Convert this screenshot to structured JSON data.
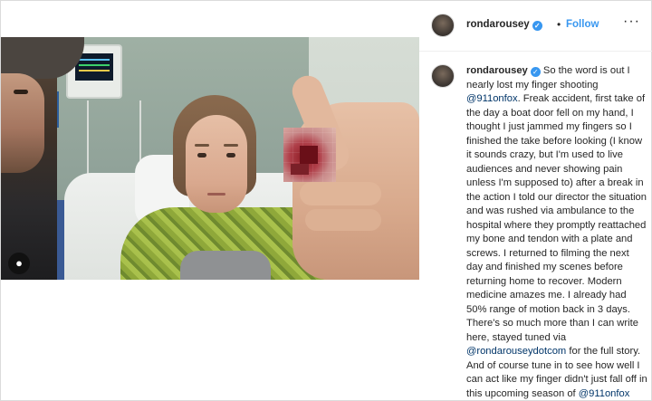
{
  "post": {
    "username": "rondarousey",
    "follow_label": "Follow",
    "more_label": "···",
    "verified_glyph": "✓",
    "dot": "•"
  },
  "caption": {
    "username": "rondarousey",
    "text_1": " So the word is out I nearly lost my finger shooting ",
    "mention_1": "@911onfox",
    "text_2": ". Freak accident, first take of the day a boat door fell on my hand, I thought I just jammed my fingers so I finished the take before looking (I know it sounds crazy, but I'm used to live audiences and never showing pain unless I'm supposed to) after a break in the action I told our director the situation and was rushed via ambulance to the hospital where they promptly reattached my bone and tendon with a plate and screws. I returned to filming the next day and finished my scenes before returning home to recover. Modern medicine amazes me. I already had 50% range of motion back in 3 days. There's so much more than I can write here, stayed tuned via ",
    "mention_2": "@rondarouseydotcom",
    "text_3": " for the full story. And of course tune in to see how well I can act like my finger didn't just fall off in this upcoming season of ",
    "mention_3": "@911onfox"
  },
  "photo": {
    "tag_icon": "user-tag-icon",
    "tag_glyph": "●"
  }
}
